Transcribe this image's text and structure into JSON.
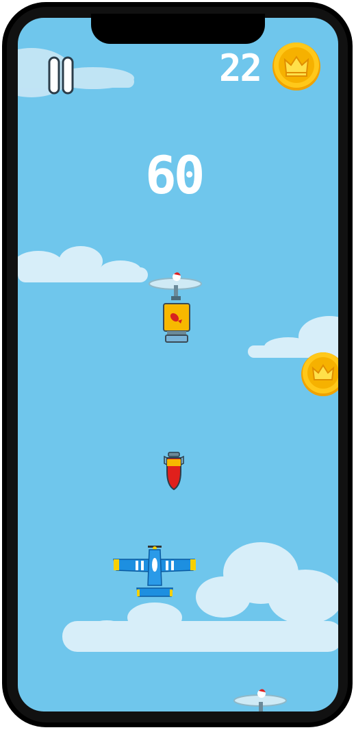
{
  "hud": {
    "coin_count": "22",
    "score": "60"
  },
  "icons": {
    "pause": "pause-icon",
    "coin": "crown-coin-icon",
    "player": "blue-propeller-plane",
    "enemy": "mini-helicopter-with-pilot",
    "cargo": "bomb-supply-crate",
    "projectile": "falling-bomb"
  },
  "colors": {
    "sky": "#6fc6ec",
    "cloud": "#d8eef8",
    "coin_gold": "#f7b500",
    "plane_blue": "#1d8fe0",
    "bomb_red": "#e0201c",
    "crate_yellow": "#f7b800"
  }
}
